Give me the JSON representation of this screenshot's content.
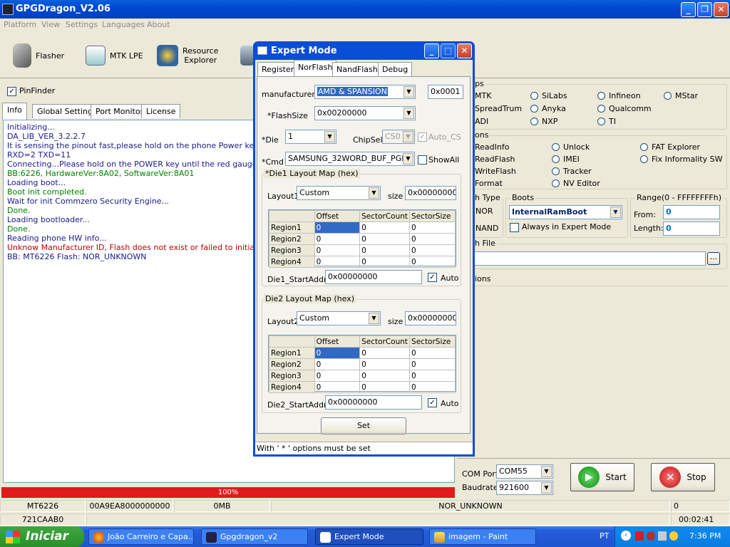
{
  "app": {
    "title": "GPGDragon_V2.06"
  },
  "menu": [
    "Platform",
    "View",
    "Settings",
    "Languages",
    "About"
  ],
  "toolbar": {
    "flasher": "Flasher",
    "mtk_lpe": "MTK LPE",
    "resource_explorer_1": "Resource",
    "resource_explorer_2": "Explorer"
  },
  "pinfinder": {
    "label": "PinFinder",
    "checked": true
  },
  "tabs": [
    "Info",
    "Global Settings",
    "Port Monitor",
    "License"
  ],
  "log": [
    {
      "text": "Initializing...",
      "color": "#1a1a8c"
    },
    {
      "text": "DA_LIB_VER_3.2.2.7",
      "color": "#1a1a8c"
    },
    {
      "text": "It is sensing the pinout fast,please hold on the phone Power key",
      "color": "#1a1a8c"
    },
    {
      "text": "RXD=2  TXD=11",
      "color": "#1a1a8c"
    },
    {
      "text": "Connecting...Please hold on the POWER key until the red gauge is going",
      "color": "#1a1a8c"
    },
    {
      "text": "BB:6226,     HardwareVer:8A02,     SoftwareVer:8A01",
      "color": "#008000"
    },
    {
      "text": "Loading boot...",
      "color": "#1a1a8c"
    },
    {
      "text": "Boot init completed.",
      "color": "#008000"
    },
    {
      "text": "Wait for init Commzero Security Engine...",
      "color": "#1a1a8c"
    },
    {
      "text": "Done.",
      "color": "#008000"
    },
    {
      "text": "Loading bootloader...",
      "color": "#1a1a8c"
    },
    {
      "text": "Done.",
      "color": "#008000"
    },
    {
      "text": "Reading phone HW info...",
      "color": "#1a1a8c"
    },
    {
      "text": "Unknow Manufacturer ID, Flash does not exist or failed to initialize H/W.",
      "color": "#c00000"
    },
    {
      "text": "BB: MT6226     Flash: NOR_UNKNOWN",
      "color": "#1a1a8c"
    }
  ],
  "progress": {
    "label": "100%",
    "value": 1.0
  },
  "chips": {
    "group_title": "ps",
    "items": [
      "MTK",
      "SiLabs",
      "Infineon",
      "MStar",
      "SpreadTrum",
      "Anyka",
      "Qualcomm",
      "ADI",
      "NXP",
      "TI"
    ]
  },
  "options": {
    "group_title": "ons",
    "items": [
      "ReadInfo",
      "Unlock",
      "FAT Explorer",
      "ReadFlash",
      "IMEI",
      "Fix Informality SW",
      "WriteFlash",
      "Tracker",
      "Format",
      "NV Editor"
    ]
  },
  "flash_type": {
    "title": "h Type",
    "nor": "NOR",
    "nand": "NAND"
  },
  "boots": {
    "title": "Boots",
    "value": "InternalRamBoot",
    "always_expert": "Always in Expert Mode"
  },
  "range": {
    "title": "Range(0 - FFFFFFFFh)",
    "from_label": "From:",
    "from": "0",
    "length_label": "Length:",
    "length": "0"
  },
  "flash_file": {
    "title": "h File",
    "browse": "..."
  },
  "ons_header": "ions",
  "com": {
    "port_label": "COM Port",
    "port": "COM55",
    "baud_label": "Baudrate",
    "baud": "921600"
  },
  "buttons": {
    "start": "Start",
    "stop": "Stop"
  },
  "status1": [
    "MT6226",
    "00A9EA8000000000",
    "0MB",
    "NOR_UNKNOWN",
    "0"
  ],
  "status2": [
    "721CAAB0",
    "00:02:41"
  ],
  "dialog": {
    "title": "Expert Mode",
    "tabs": [
      "Register",
      "NorFlash",
      "NandFlash",
      "Debug"
    ],
    "manufacturer_label": "manufacturer",
    "manufacturer": "AMD & SPANSION",
    "manufacturer_id": "0x0001",
    "flashsize_label": "*FlashSize",
    "flashsize": "0x00200000",
    "die_label": "*Die",
    "die": "1",
    "chipsel_label": "ChipSel",
    "chipsel": "CS0",
    "auto_cs": "Auto_CS",
    "cmd_label": "*Cmd",
    "cmd": "SAMSUNG_32WORD_BUF_PGM",
    "showall": "ShowAll",
    "die1": {
      "title": "*Die1 Layout Map (hex)",
      "layout_label": "Layout1",
      "layout": "Custom",
      "size_label": "size",
      "size": "0x00000000",
      "start_label": "Die1_StartAddr",
      "start": "0x00000000",
      "auto": "Auto"
    },
    "die2": {
      "title": "Die2 Layout Map (hex)",
      "layout_label": "Layout2",
      "layout": "Custom",
      "size_label": "size",
      "size": "0x00000000",
      "start_label": "Die2_StartAddr",
      "start": "0x00000000",
      "auto": "Auto"
    },
    "grid_headers": [
      "",
      "Offset",
      "SectorCount",
      "SectorSize"
    ],
    "grid_rows": [
      [
        "Region1",
        "0",
        "0",
        "0"
      ],
      [
        "Region2",
        "0",
        "0",
        "0"
      ],
      [
        "Region3",
        "0",
        "0",
        "0"
      ],
      [
        "Region4",
        "0",
        "0",
        "0"
      ]
    ],
    "set": "Set",
    "status": "With ' * ' options must be set"
  },
  "taskbar": {
    "start": "Iniciar",
    "items": [
      "João Carreiro e Capa...",
      "Gpgdragon_v2",
      "Expert Mode",
      "imagem - Paint"
    ],
    "lang": "PT",
    "time": "7:36 PM"
  }
}
